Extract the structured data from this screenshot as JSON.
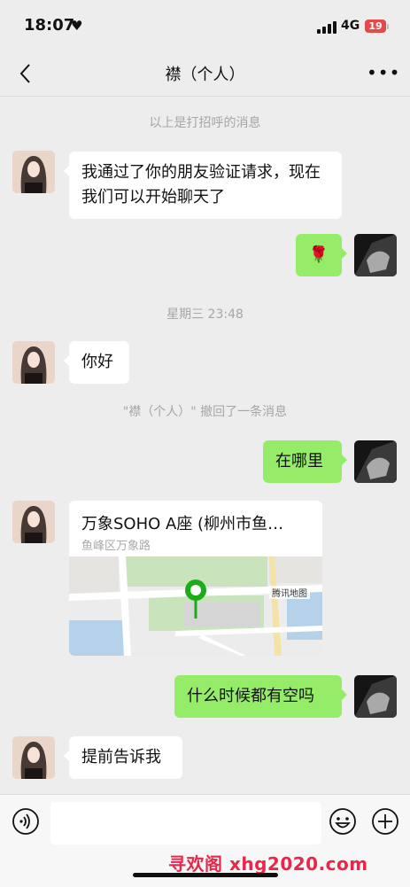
{
  "status_bar": {
    "time": "18:07",
    "network": "4G",
    "battery": "19"
  },
  "header": {
    "title": "襟（个人）"
  },
  "chat": {
    "greeting_notice": "以上是打招呼的消息",
    "msg_verify": "我通过了你的朋友验证请求，现在我们可以开始聊天了",
    "msg_rose": "🌹",
    "timestamp": "星期三 23:48",
    "msg_hello": "你好",
    "recall_notice": "\"襟（个人）\" 撤回了一条消息",
    "msg_where": "在哪里",
    "location": {
      "title": "万象SOHO A座 (柳州市鱼…",
      "address": "鱼峰区万象路",
      "map_provider": "腾讯地图"
    },
    "msg_free": "什么时候都有空吗",
    "msg_tell": "提前告诉我"
  },
  "input_bar": {
    "watermark": "寻欢阁 xhg2020.com"
  },
  "colors": {
    "outgoing": "#95ec69",
    "incoming": "#ffffff",
    "background": "#ededed",
    "pin": "#1aad19"
  }
}
